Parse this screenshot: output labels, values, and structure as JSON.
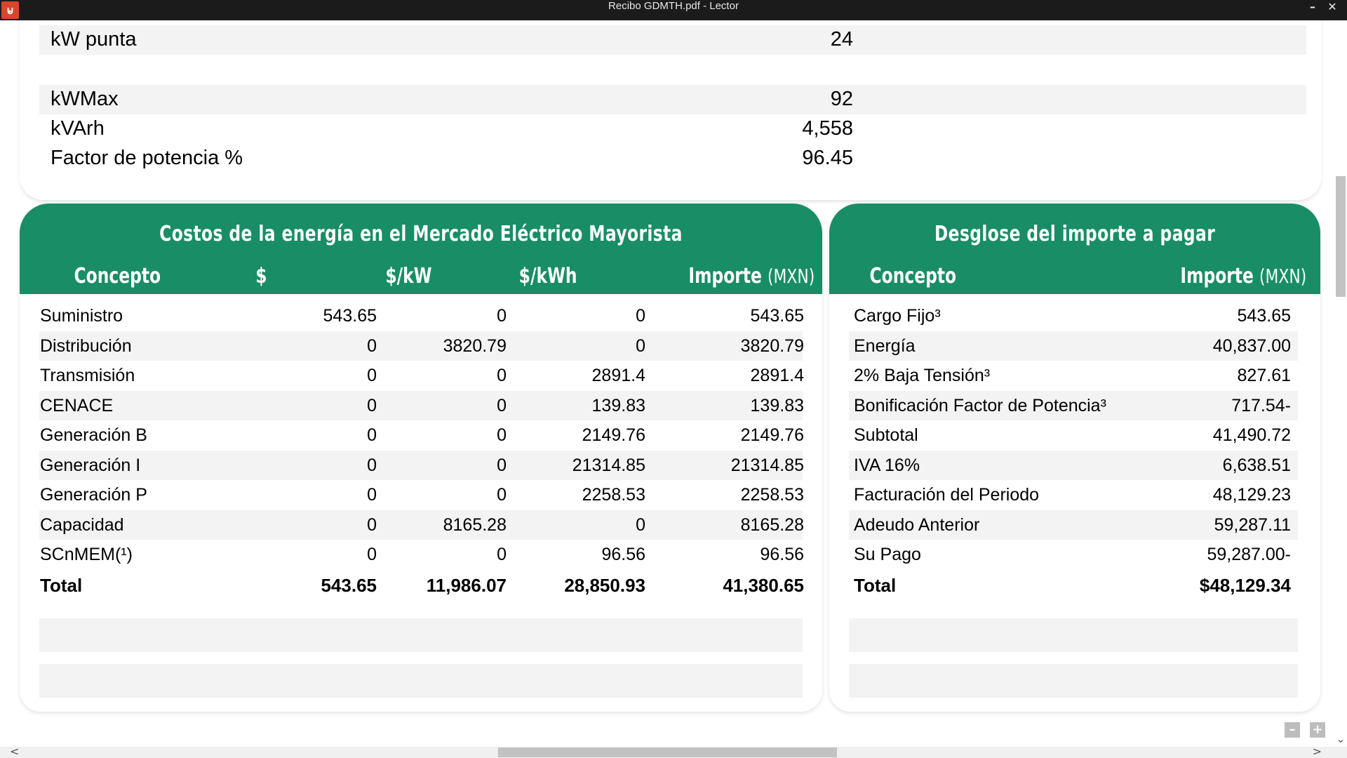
{
  "window": {
    "title": "Recibo GDMTH.pdf - Lector",
    "app_icon": "lector-app-icon",
    "minimize_glyph": "–",
    "close_glyph": "✕"
  },
  "metrics": [
    {
      "label": "kW punta",
      "value": "24"
    },
    {
      "label": "kWMax",
      "value": "92"
    },
    {
      "label": "kVArh",
      "value": "4,558"
    },
    {
      "label": "Factor de potencia %",
      "value": "96.45"
    }
  ],
  "costs": {
    "title": "Costos de la energía en el Mercado Eléctrico Mayorista",
    "headers": {
      "concepto": "Concepto",
      "pesos": "$",
      "per_kw": "$/kW",
      "per_kwh": "$/kWh",
      "importe": "Importe",
      "unit": "(MXN)"
    },
    "rows": [
      [
        "Suministro",
        "543.65",
        "0",
        "0",
        "543.65"
      ],
      [
        "Distribución",
        "0",
        "3820.79",
        "0",
        "3820.79"
      ],
      [
        "Transmisión",
        "0",
        "0",
        "2891.4",
        "2891.4"
      ],
      [
        "CENACE",
        "0",
        "0",
        "139.83",
        "139.83"
      ],
      [
        "Generación B",
        "0",
        "0",
        "2149.76",
        "2149.76"
      ],
      [
        "Generación I",
        "0",
        "0",
        "21314.85",
        "21314.85"
      ],
      [
        "Generación P",
        "0",
        "0",
        "2258.53",
        "2258.53"
      ],
      [
        "Capacidad",
        "0",
        "8165.28",
        "0",
        "8165.28"
      ],
      [
        "SCnMEM(¹)",
        "0",
        "0",
        "96.56",
        "96.56"
      ]
    ],
    "total": [
      "Total",
      "543.65",
      "11,986.07",
      "28,850.93",
      "41,380.65"
    ]
  },
  "breakdown": {
    "title": "Desglose del importe a pagar",
    "headers": {
      "concepto": "Concepto",
      "importe": "Importe",
      "unit": "(MXN)"
    },
    "rows": [
      [
        "Cargo Fijo³",
        "543.65"
      ],
      [
        "Energía",
        "40,837.00"
      ],
      [
        "2% Baja Tensión³",
        "827.61"
      ],
      [
        "Bonificación Factor de Potencia³",
        "717.54-"
      ],
      [
        "Subtotal",
        "41,490.72"
      ],
      [
        "IVA 16%",
        "6,638.51"
      ],
      [
        "Facturación del Periodo",
        "48,129.23"
      ],
      [
        "Adeudo Anterior",
        "59,287.11"
      ],
      [
        "Su Pago",
        "59,287.00-"
      ]
    ],
    "total": [
      "Total",
      "$48,129.34"
    ]
  },
  "controls": {
    "zoom_out": "–",
    "zoom_in": "+",
    "scroll_left": "<",
    "scroll_right": ">",
    "scroll_down": "⌄"
  },
  "colors": {
    "header_green": "#188d66",
    "titlebar": "#1b1b1b",
    "row_shade": "#f3f3f3"
  }
}
